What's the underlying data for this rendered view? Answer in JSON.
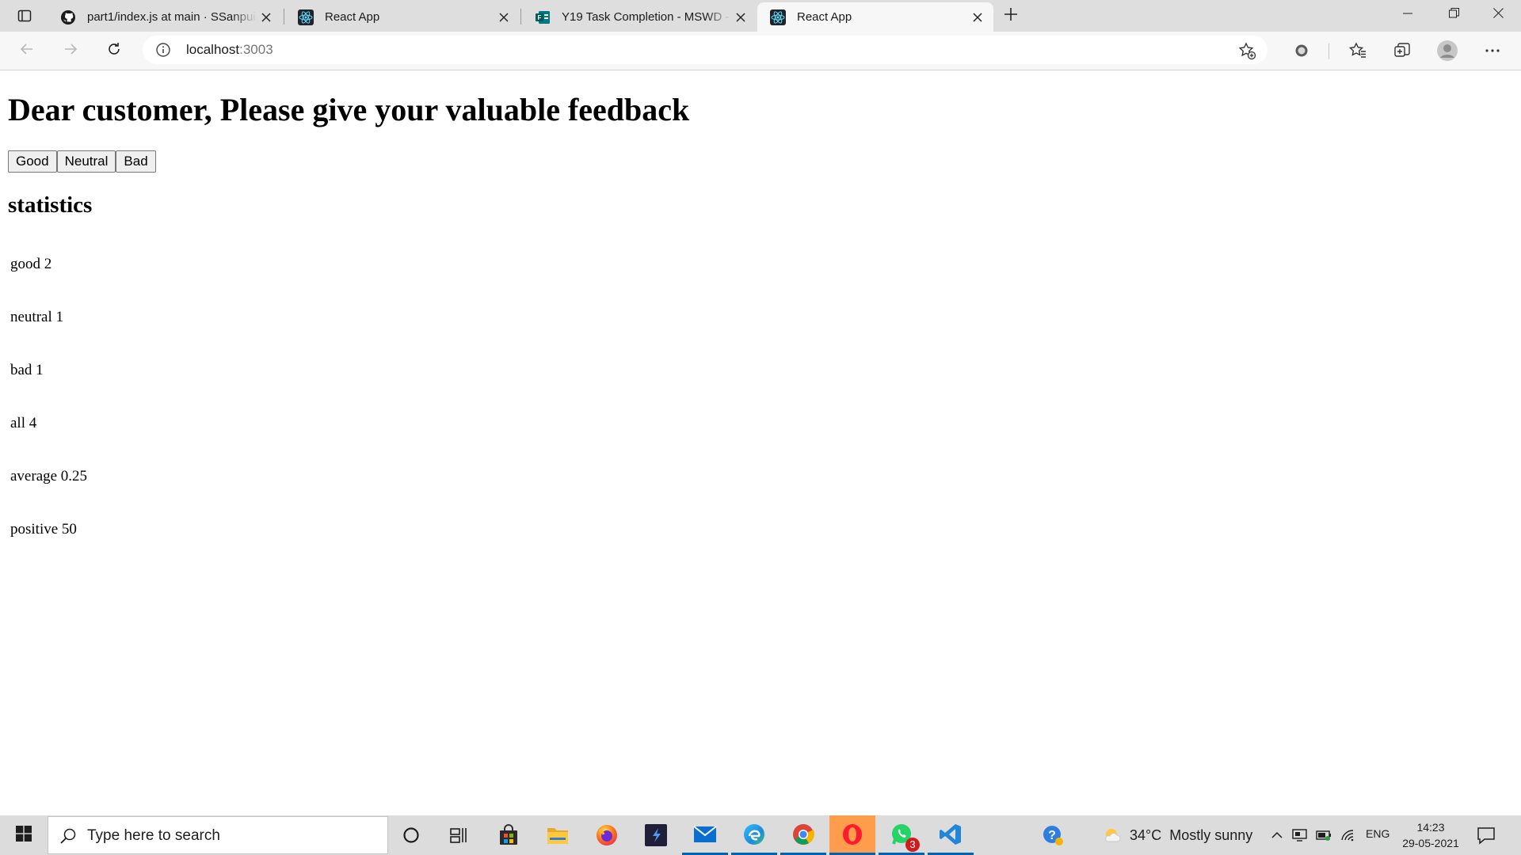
{
  "browser": {
    "tabs": [
      {
        "title": "part1/index.js at main · SSanpui/",
        "favicon": "github-icon",
        "active": false
      },
      {
        "title": "React App",
        "favicon": "react-icon",
        "active": false
      },
      {
        "title": "Y19 Task Completion - MSWD - ",
        "favicon": "forms-icon",
        "active": false
      },
      {
        "title": "React App",
        "favicon": "react-icon",
        "active": true
      }
    ],
    "address": {
      "host": "localhost",
      "port": ":3003"
    }
  },
  "page": {
    "heading": "Dear customer, Please give your valuable feedback",
    "buttons": {
      "good": "Good",
      "neutral": "Neutral",
      "bad": "Bad"
    },
    "stats_heading": "statistics",
    "stats": [
      {
        "label": "good",
        "value": "2",
        "text": "good 2"
      },
      {
        "label": "neutral",
        "value": "1",
        "text": "neutral 1"
      },
      {
        "label": "bad",
        "value": "1",
        "text": "bad 1"
      },
      {
        "label": "all",
        "value": "4",
        "text": "all 4"
      },
      {
        "label": "average",
        "value": "0.25",
        "text": "average 0.25"
      },
      {
        "label": "positive",
        "value": "50",
        "text": "positive 50"
      }
    ]
  },
  "taskbar": {
    "search_placeholder": "Type here to search",
    "apps": [
      "cortana-icon",
      "task-view-icon",
      "store-icon",
      "file-explorer-icon",
      "firefox-icon",
      "visual-studio-icon",
      "mail-icon",
      "edge-icon",
      "chrome-icon",
      "opera-icon",
      "whatsapp-icon",
      "vscode-icon"
    ],
    "whatsapp_badge": "3",
    "weather": {
      "temp": "34°C",
      "condition": "Mostly sunny"
    },
    "language": "ENG",
    "time": "14:23",
    "date": "29-05-2021"
  },
  "colors": {
    "accent": "#0063b1",
    "tabstrip": "#dedede",
    "toolbar": "#f7f7f7",
    "taskbar": "#dcdcdc",
    "opera_highlight": "#ff9d4d"
  }
}
